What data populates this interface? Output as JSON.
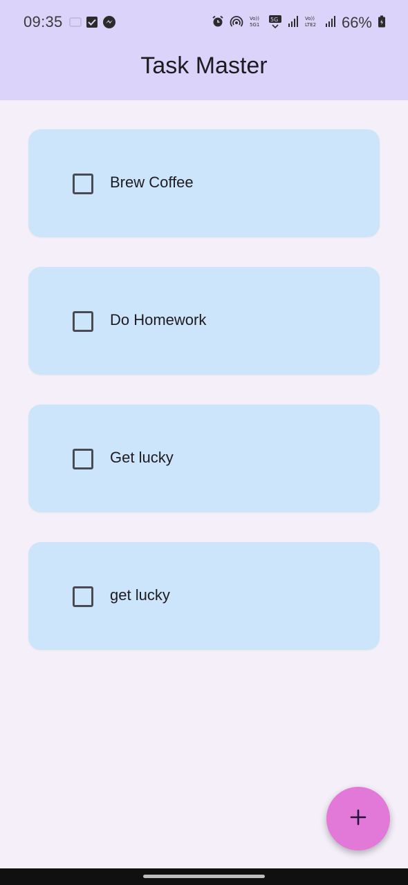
{
  "status_bar": {
    "time": "09:35",
    "battery": "66%",
    "left_icons": [
      "image-icon",
      "check-box-icon",
      "messenger-icon"
    ],
    "right_icons": [
      "alarm-icon",
      "hotspot-icon",
      "volte-5g-icon",
      "5g-icon",
      "signal-icon",
      "volte-lte-icon",
      "signal-icon",
      "battery-icon"
    ]
  },
  "app_bar": {
    "title": "Task Master"
  },
  "tasks": [
    {
      "label": "Brew Coffee",
      "checked": false
    },
    {
      "label": "Do Homework",
      "checked": false
    },
    {
      "label": "Get lucky",
      "checked": false
    },
    {
      "label": "get lucky",
      "checked": false
    }
  ],
  "fab": {
    "icon": "plus-icon"
  },
  "colors": {
    "app_bar_bg": "#dcd3fb",
    "page_bg": "#f4eff9",
    "card_bg": "#cce5fb",
    "fab_bg": "#e278d8",
    "nav_bar_bg": "#101010"
  }
}
